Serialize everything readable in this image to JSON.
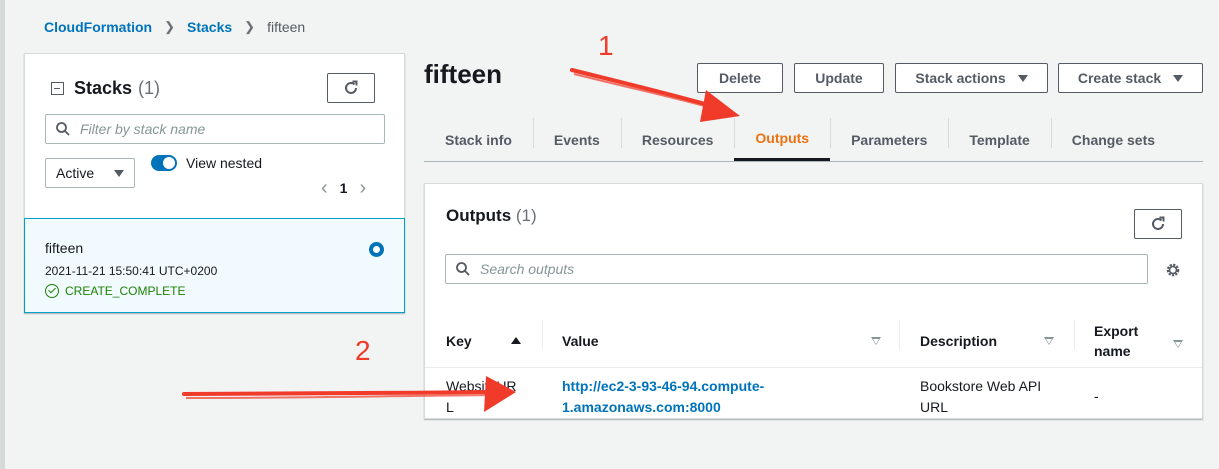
{
  "breadcrumb": {
    "items": [
      "CloudFormation",
      "Stacks"
    ],
    "current": "fifteen"
  },
  "sidebar": {
    "title": "Stacks",
    "count": "(1)",
    "search_placeholder": "Filter by stack name",
    "status_filter": "Active",
    "view_nested_label": "View nested",
    "view_nested_on": true,
    "page": "1",
    "stack": {
      "name": "fifteen",
      "date": "2021-11-21 15:50:41 UTC+0200",
      "status": "CREATE_COMPLETE"
    }
  },
  "header": {
    "title": "fifteen",
    "buttons": {
      "delete": "Delete",
      "update": "Update",
      "stack_actions": "Stack actions",
      "create_stack": "Create stack"
    }
  },
  "tabs": [
    {
      "label": "Stack info",
      "active": false
    },
    {
      "label": "Events",
      "active": false
    },
    {
      "label": "Resources",
      "active": false
    },
    {
      "label": "Outputs",
      "active": true
    },
    {
      "label": "Parameters",
      "active": false
    },
    {
      "label": "Template",
      "active": false
    },
    {
      "label": "Change sets",
      "active": false
    }
  ],
  "outputs": {
    "title": "Outputs",
    "count": "(1)",
    "search_placeholder": "Search outputs",
    "columns": {
      "key": "Key",
      "value": "Value",
      "description": "Description",
      "export_line1": "Export",
      "export_line2": "name"
    },
    "row": {
      "key_line1": "WebsiteUR",
      "key_line2": "L",
      "value_line1": "http://ec2-3-93-46-94.compute-",
      "value_line2": "1.amazonaws.com:8000",
      "description_line1": "Bookstore Web API",
      "description_line2": "URL",
      "export": "-"
    }
  },
  "annotations": {
    "one": "1",
    "two": "2",
    "color": "#f03a2a"
  },
  "colors": {
    "link": "#0073bb",
    "active_tab": "#ec7211",
    "success": "#1d8102"
  }
}
